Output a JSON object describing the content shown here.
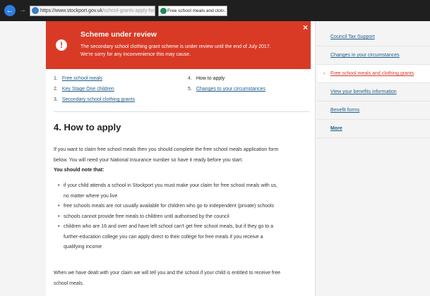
{
  "browser": {
    "url_prefix": "https://",
    "url_domain": "www.stockport.gov.uk",
    "url_path": "/school-grants-apply-for",
    "tab_title": "Free school meals and clot..."
  },
  "alert": {
    "title": "Scheme under review",
    "line1": "The secondary school clothing grant scheme is under review until the end of July 2017.",
    "line2": "We're sorry for any inconvenience this may cause.",
    "close": "×"
  },
  "toc": {
    "items": [
      {
        "num": "1.",
        "label": "Free school meals"
      },
      {
        "num": "2.",
        "label": "Key Stage One children"
      },
      {
        "num": "3.",
        "label": "Secondary school clothing grants"
      },
      {
        "num": "4.",
        "label": "How to apply"
      },
      {
        "num": "5.",
        "label": "Changes to your circumstances"
      }
    ]
  },
  "section": {
    "heading": "4. How to apply",
    "para1_line1": "If you want to claim free school meals then you should complete the free school meals application form",
    "para1_line2": "below. You will need your National Insurance number so have it ready before you start.",
    "note_heading": "You should note that:",
    "bullets": [
      {
        "line1": "if your child attends a school in Stockport you must make your claim for free school meals with us,",
        "line2": "no matter where you live"
      },
      {
        "line1": "free schools meals are not usually available for children who go to independent (private) schools",
        "line2": ""
      },
      {
        "line1": "schools cannot provide free meals to children until authorised by the council",
        "line2": ""
      },
      {
        "line1": "children who are 16 and over and have left school can't get free school meals, but if they go to a",
        "line2": "further-education college you can apply direct to their college for free meals if you receive a",
        "line3": "qualifying income"
      }
    ],
    "para2_line1": "When we have dealt with your claim we will tell you and the school if your child is entitled to receive free",
    "para2_line2": "school meals."
  },
  "sidebar": {
    "items": [
      {
        "label": "Council Tax Support"
      },
      {
        "label": "Changes in your circumstances"
      },
      {
        "label": "Free school meals and clothing grants"
      },
      {
        "label": "View your benefits information"
      },
      {
        "label": "Benefit forms"
      },
      {
        "label": "More"
      }
    ]
  },
  "colors": {
    "accent": "#d93a26",
    "link": "#1a5d8c"
  }
}
